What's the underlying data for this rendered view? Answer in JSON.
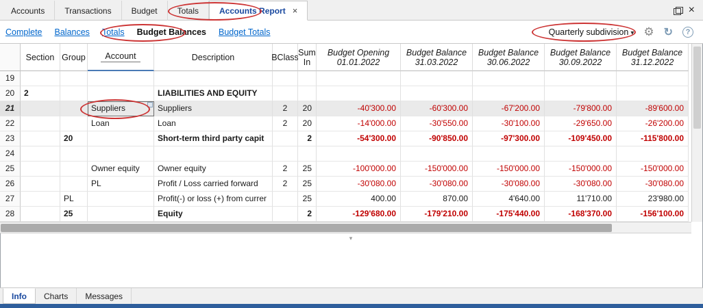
{
  "window": {
    "tabs": [
      {
        "label": "Accounts",
        "active": false
      },
      {
        "label": "Transactions",
        "active": false
      },
      {
        "label": "Budget",
        "active": false
      },
      {
        "label": "Totals",
        "active": false
      },
      {
        "label": "Accounts Report",
        "active": true,
        "closable": true,
        "close_glyph": "×"
      }
    ],
    "close_glyph": "×"
  },
  "toolbar": {
    "links": [
      {
        "label": "Complete",
        "active": false
      },
      {
        "label": "Balances",
        "active": false
      },
      {
        "label": "Totals",
        "active": false
      },
      {
        "label": "Budget Balances",
        "active": true
      },
      {
        "label": "Budget Totals",
        "active": false
      }
    ],
    "dropdown_label": "Quarterly subdivision",
    "dropdown_arrow": "▾",
    "gear_glyph": "⚙",
    "refresh_glyph": "↻",
    "help_glyph": "?"
  },
  "table": {
    "columns": [
      {
        "id": "section",
        "label": "Section",
        "label2": ""
      },
      {
        "id": "group",
        "label": "Group",
        "label2": ""
      },
      {
        "id": "account",
        "label": "Account",
        "label2": "",
        "selected": true
      },
      {
        "id": "description",
        "label": "Description",
        "label2": ""
      },
      {
        "id": "bclass",
        "label": "BClass",
        "label2": ""
      },
      {
        "id": "sum",
        "label": "Sum",
        "label2": "In"
      },
      {
        "id": "v0",
        "label": "Budget Opening",
        "label2": "01.01.2022",
        "numeric": true
      },
      {
        "id": "v1",
        "label": "Budget Balance",
        "label2": "31.03.2022",
        "numeric": true
      },
      {
        "id": "v2",
        "label": "Budget Balance",
        "label2": "30.06.2022",
        "numeric": true
      },
      {
        "id": "v3",
        "label": "Budget Balance",
        "label2": "30.09.2022",
        "numeric": true
      },
      {
        "id": "v4",
        "label": "Budget Balance",
        "label2": "31.12.2022",
        "numeric": true
      }
    ],
    "rows": [
      {
        "num": "19",
        "section": "",
        "group": "",
        "account": "",
        "description": "",
        "bclass": "",
        "sum": "",
        "values": [
          "",
          "",
          "",
          "",
          ""
        ],
        "kind": "empty"
      },
      {
        "num": "20",
        "section": "2",
        "group": "",
        "account": "",
        "description": "LIABILITIES AND EQUITY",
        "bclass": "",
        "sum": "",
        "values": [
          "",
          "",
          "",
          "",
          ""
        ],
        "kind": "heading"
      },
      {
        "num": "21",
        "section": "",
        "group": "",
        "account": "Suppliers",
        "description": "Suppliers",
        "bclass": "2",
        "sum": "20",
        "values": [
          "-40'300.00",
          "-60'300.00",
          "-67'200.00",
          "-79'800.00",
          "-89'600.00"
        ],
        "kind": "selected"
      },
      {
        "num": "22",
        "section": "",
        "group": "",
        "account": "Loan",
        "description": "Loan",
        "bclass": "2",
        "sum": "20",
        "values": [
          "-14'000.00",
          "-30'550.00",
          "-30'100.00",
          "-29'650.00",
          "-26'200.00"
        ],
        "kind": "normal"
      },
      {
        "num": "23",
        "section": "",
        "group": "20",
        "account": "",
        "description": "Short-term third party capit",
        "bclass": "",
        "sum": "2",
        "values": [
          "-54'300.00",
          "-90'850.00",
          "-97'300.00",
          "-109'450.00",
          "-115'800.00"
        ],
        "kind": "total"
      },
      {
        "num": "24",
        "section": "",
        "group": "",
        "account": "",
        "description": "",
        "bclass": "",
        "sum": "",
        "values": [
          "",
          "",
          "",
          "",
          ""
        ],
        "kind": "empty"
      },
      {
        "num": "25",
        "section": "",
        "group": "",
        "account": "Owner equity",
        "description": "Owner equity",
        "bclass": "2",
        "sum": "25",
        "values": [
          "-100'000.00",
          "-150'000.00",
          "-150'000.00",
          "-150'000.00",
          "-150'000.00"
        ],
        "kind": "normal"
      },
      {
        "num": "26",
        "section": "",
        "group": "",
        "account": "PL",
        "description": "Profit / Loss carried forward",
        "bclass": "2",
        "sum": "25",
        "values": [
          "-30'080.00",
          "-30'080.00",
          "-30'080.00",
          "-30'080.00",
          "-30'080.00"
        ],
        "kind": "normal"
      },
      {
        "num": "27",
        "section": "",
        "group": "PL",
        "account": "",
        "description": "Profit(-) or loss (+) from currer",
        "bclass": "",
        "sum": "25",
        "values": [
          "400.00",
          "870.00",
          "4'640.00",
          "11'710.00",
          "23'980.00"
        ],
        "kind": "normal"
      },
      {
        "num": "28",
        "section": "",
        "group": "25",
        "account": "",
        "description": "Equity",
        "bclass": "",
        "sum": "2",
        "values": [
          "-129'680.00",
          "-179'210.00",
          "-175'440.00",
          "-168'370.00",
          "-156'100.00"
        ],
        "kind": "total"
      }
    ]
  },
  "bottom_tabs": [
    {
      "label": "Info",
      "active": true
    },
    {
      "label": "Charts",
      "active": false
    },
    {
      "label": "Messages",
      "active": false
    }
  ],
  "splitter_glyph": "▾",
  "colors": {
    "negative": "#c00000",
    "link_blue": "#0066cc",
    "active_tab_blue": "#17479e",
    "annotation_red": "#cc3333",
    "status_bar_blue": "#2e5e9c"
  }
}
